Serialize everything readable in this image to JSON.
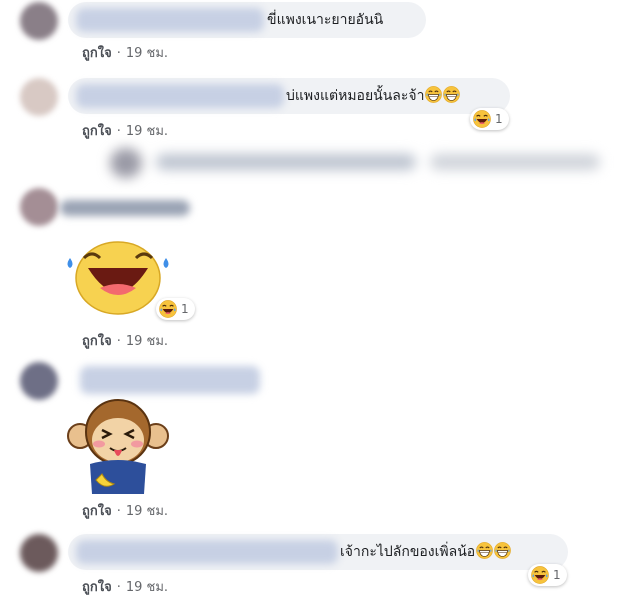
{
  "comments": [
    {
      "text": "ขี่แพงเนาะยายอันนิ",
      "like": "ถูกใจ",
      "time": "19 ชม."
    },
    {
      "text": "บ่แพงแต่หมอยนั้นละจ้า",
      "like": "ถูกใจ",
      "time": "19 ชม.",
      "reaction_count": "1"
    },
    {
      "sticker": "laughing-face-sticker",
      "like": "ถูกใจ",
      "time": "19 ชม.",
      "reaction_count": "1"
    },
    {
      "sticker": "monkey-tongue-sticker",
      "like": "ถูกใจ",
      "time": "19 ชม."
    },
    {
      "text": "เจ้ากะไปลักของเพิ่ลน้อ",
      "like": "ถูกใจ",
      "time": "19 ชม.",
      "reaction_count": "1"
    }
  ],
  "colors": {
    "bubble": "#f0f2f5",
    "meta_text": "#65676b",
    "emoji_yellow": "#f7c33c"
  },
  "icons": {
    "reaction": "laughing-tears-emoji"
  }
}
